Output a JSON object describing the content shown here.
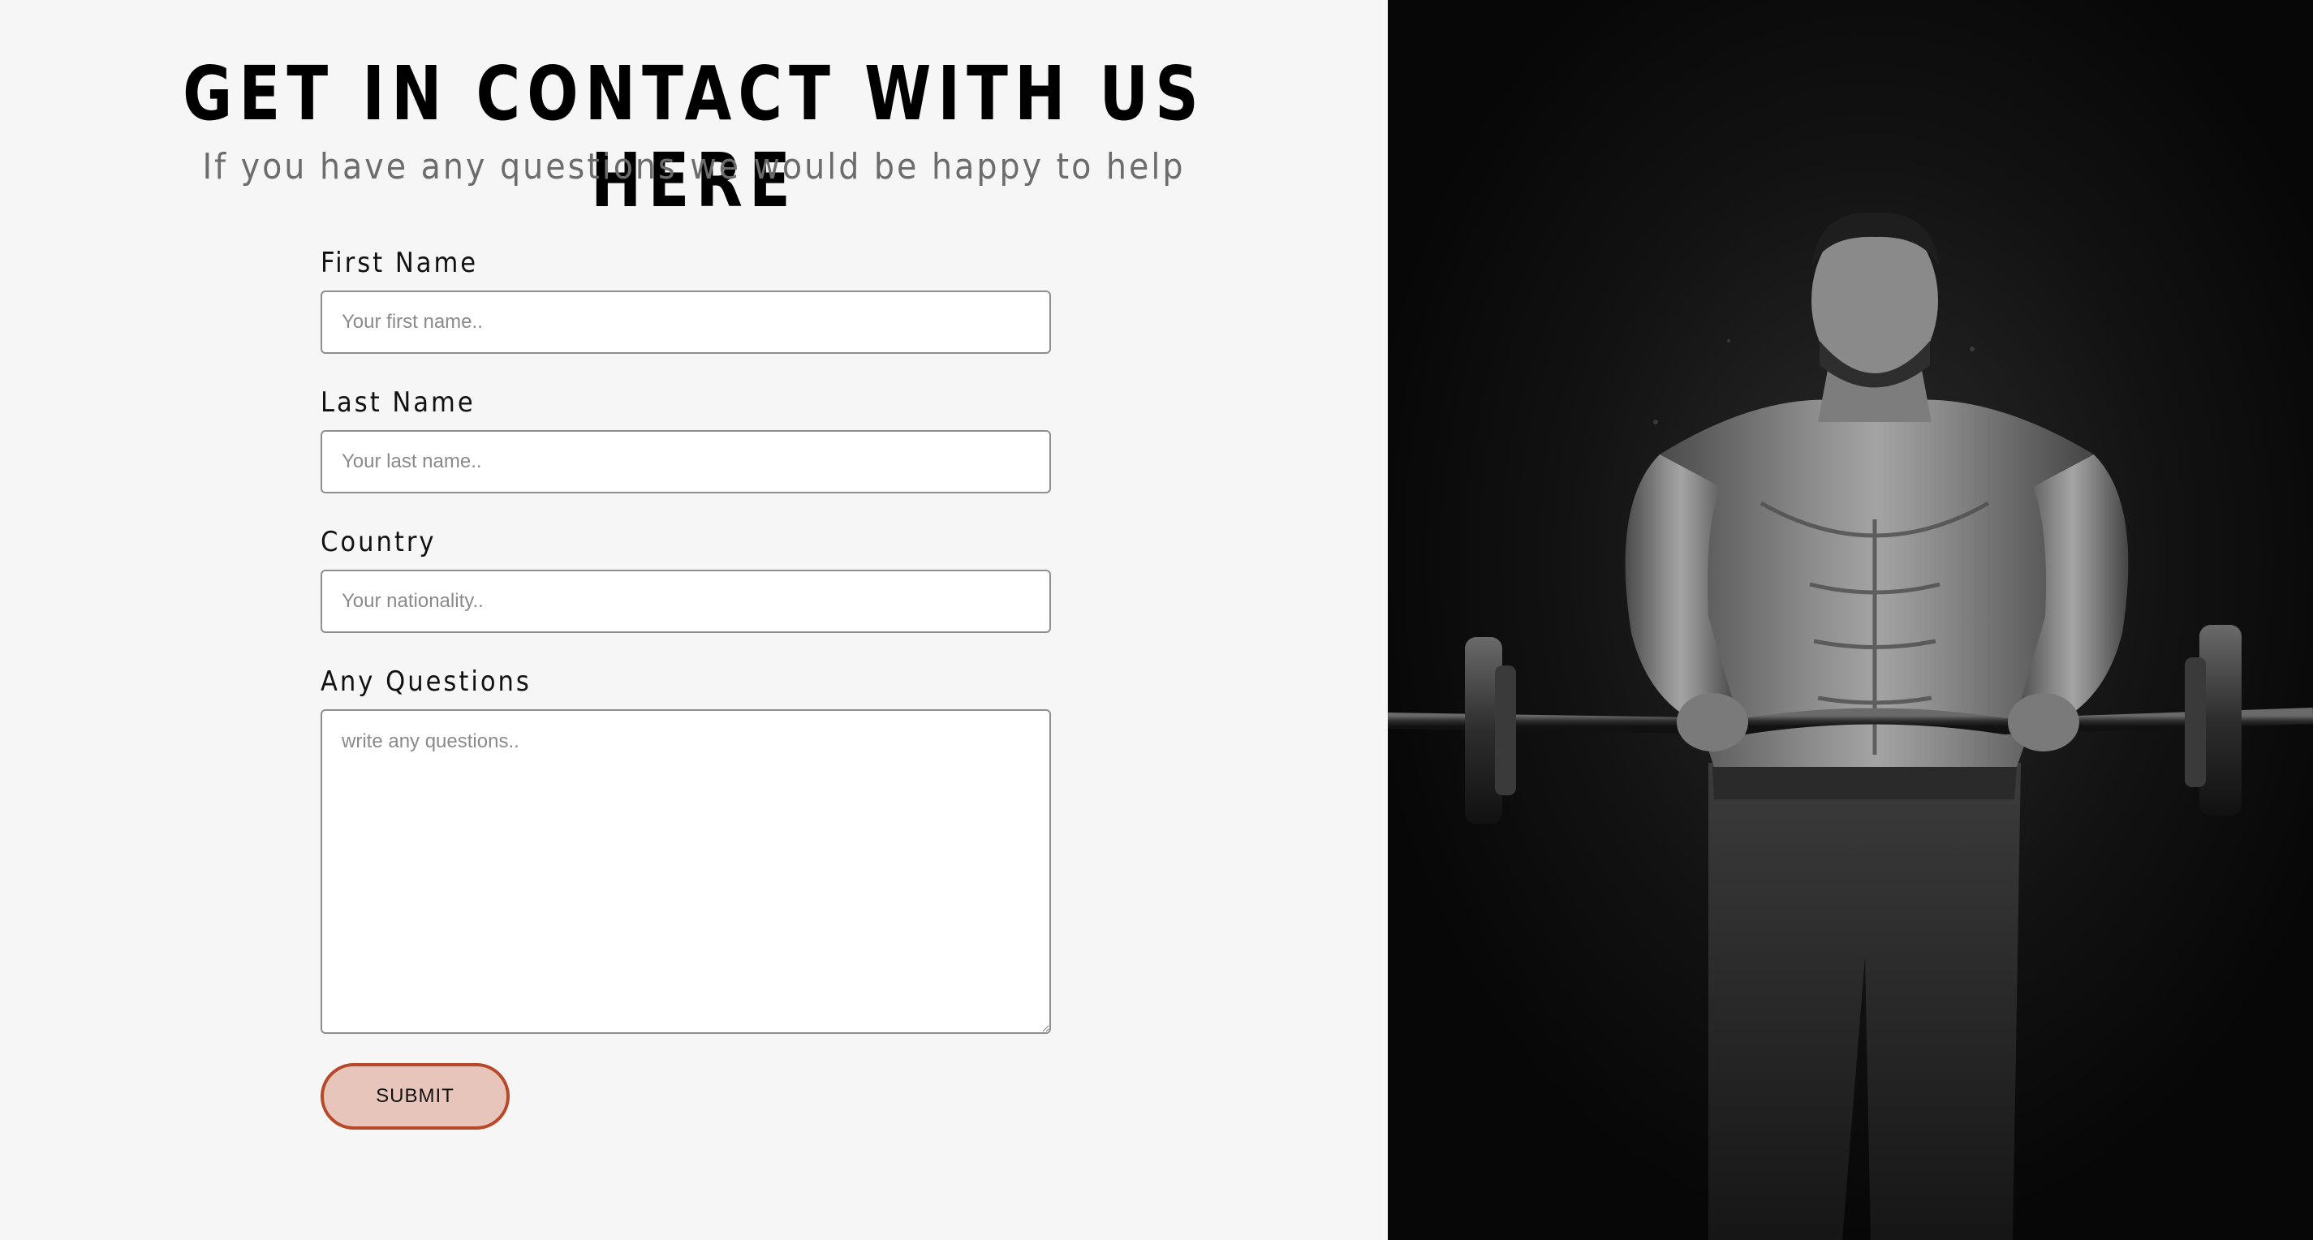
{
  "header": {
    "title": "GET IN CONTACT WITH US HERE",
    "subtitle": "If you have any questions we would be happy to help"
  },
  "form": {
    "first_name": {
      "label": "First Name",
      "placeholder": "Your first name.."
    },
    "last_name": {
      "label": "Last Name",
      "placeholder": "Your last name.."
    },
    "country": {
      "label": "Country",
      "placeholder": "Your nationality.."
    },
    "questions": {
      "label": "Any Questions",
      "placeholder": "write any questions.."
    },
    "submit_label": "SUBMIT"
  },
  "colors": {
    "page_background": "#f6f6f6",
    "hero_background": "#0b0b0b",
    "submit_fill": "#e8c5ba",
    "submit_border": "#b7492a"
  },
  "hero": {
    "icon": "bodybuilder-barbell-photo"
  }
}
